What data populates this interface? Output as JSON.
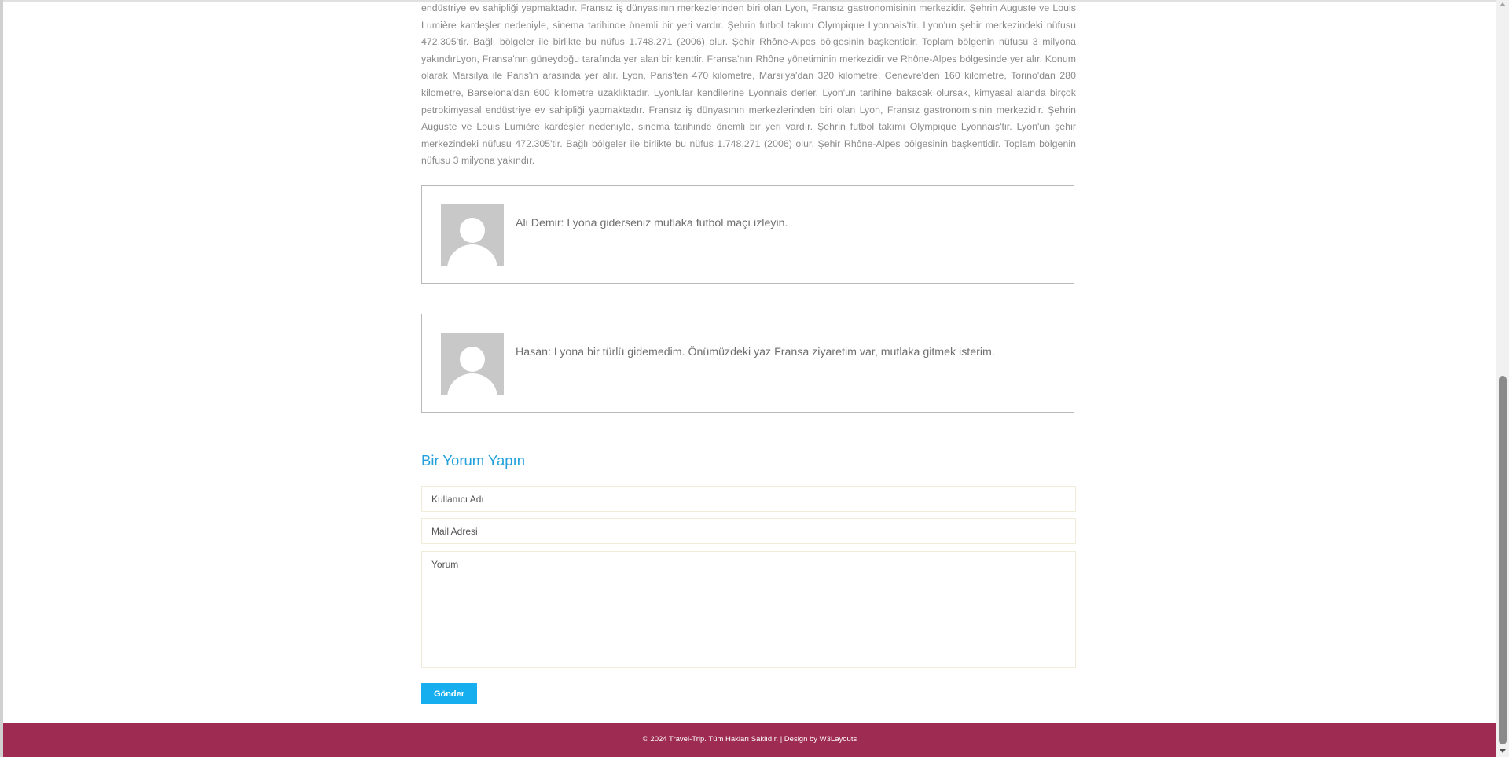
{
  "article": {
    "text": "endüstriye ev sahipliği yapmaktadır. Fransız iş dünyasının merkezlerinden biri olan Lyon, Fransız gastronomisinin merkezidir. Şehrin Auguste ve Louis Lumière kardeşler nedeniyle, sinema tarihinde önemli bir yeri vardır. Şehrin futbol takımı Olympique Lyonnais'tir. Lyon'un şehir merkezindeki nüfusu 472.305'tir. Bağlı bölgeler ile birlikte bu nüfus 1.748.271 (2006) olur. Şehir Rhône-Alpes bölgesinin başkentidir. Toplam bölgenin nüfusu 3 milyona yakındırLyon, Fransa'nın güneydoğu tarafında yer alan bir kenttir. Fransa'nın Rhône yönetiminin merkezidir ve Rhône-Alpes bölgesinde yer alır. Konum olarak Marsilya ile Paris'in arasında yer alır. Lyon, Paris'ten 470 kilometre, Marsilya'dan 320 kilometre, Cenevre'den 160 kilometre, Torino'dan 280 kilometre, Barselona'dan 600 kilometre uzaklıktadır. Lyonlular kendilerine Lyonnais derler. Lyon'un tarihine bakacak olursak, kimyasal alanda birçok petrokimyasal endüstriye ev sahipliği yapmaktadır. Fransız iş dünyasının merkezlerinden biri olan Lyon, Fransız gastronomisinin merkezidir. Şehrin Auguste ve Louis Lumière kardeşler nedeniyle, sinema tarihinde önemli bir yeri vardır. Şehrin futbol takımı Olympique Lyonnais'tir. Lyon'un şehir merkezindeki nüfusu 472.305'tir. Bağlı bölgeler ile birlikte bu nüfus 1.748.271 (2006) olur. Şehir Rhône-Alpes bölgesinin başkentidir. Toplam bölgenin nüfusu 3 milyona yakındır."
  },
  "comments": [
    {
      "text": "Ali Demir: Lyona giderseniz mutlaka futbol maçı izleyin."
    },
    {
      "text": "Hasan: Lyona bir türlü gidemedim. Önümüzdeki yaz Fransa ziyaretim var, mutlaka gitmek isterim."
    }
  ],
  "form": {
    "title": "Bir Yorum Yapın",
    "username_placeholder": "Kullanıcı Adı",
    "email_placeholder": "Mail Adresi",
    "comment_placeholder": "Yorum",
    "submit_label": "Gönder"
  },
  "footer": {
    "text": "© 2024 Travel-Trip. Tüm Hakları Saklıdır. | Design by W3Layouts"
  },
  "colors": {
    "accent": "#21a0dc",
    "button": "#17aef0",
    "footer_bg": "#9d2b52"
  },
  "icons": {
    "avatar": "default-user-avatar-icon"
  }
}
